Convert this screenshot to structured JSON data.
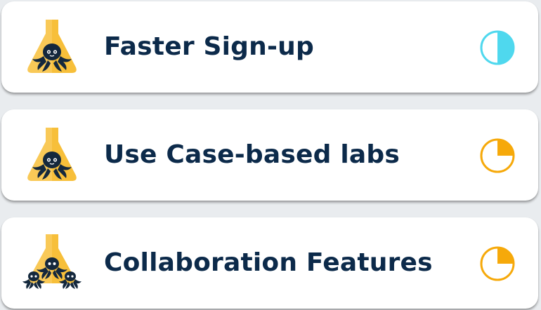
{
  "colors": {
    "card_title": "#0c2a4a",
    "half_status": "#4fd8ee",
    "quarter_status": "#f6a90a",
    "flask": "#f7bf3a",
    "octopus": "#14283d"
  },
  "items": [
    {
      "title": "Faster Sign-up",
      "icon": "flask-octopus-icon",
      "status_icon": "half-circle-status-icon",
      "progress": 0.5
    },
    {
      "title": "Use Case-based labs",
      "icon": "flask-octopus-icon",
      "status_icon": "quarter-circle-status-icon",
      "progress": 0.25
    },
    {
      "title": "Collaboration Features",
      "icon": "flask-three-octopus-icon",
      "status_icon": "quarter-circle-status-icon",
      "progress": 0.25
    }
  ]
}
